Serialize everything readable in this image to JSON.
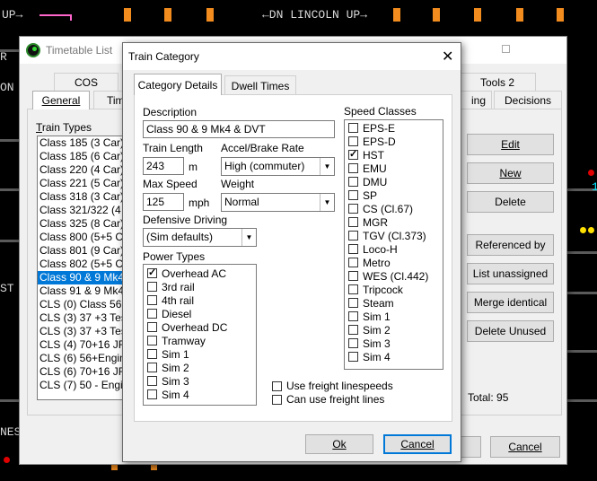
{
  "background": {
    "top_left_label": "UP→",
    "center_label": "←DN LINCOLN UP→",
    "left_labels": [
      "R",
      "ON",
      "ST",
      "NES"
    ],
    "right_label": "1"
  },
  "timetable_window": {
    "title": "Timetable List",
    "tabs_row1": [
      "COS",
      "Tools 2"
    ],
    "tabs_row2": [
      "General",
      "Tim",
      "ing",
      "Decisions"
    ],
    "train_types_label": "Train Types",
    "train_types": [
      "Class 185 (3 Car)",
      "Class 185 (6 Car)",
      "Class 220 (4 Car)",
      "Class 221 (5 Car)",
      "Class 318 (3 Car)",
      "Class 321/322 (4",
      "Class 325 (8 Car)",
      "Class 800 (5+5 C",
      "Class 801 (9 Car)",
      "Class 802 (5+5 C",
      "Class 90 & 9 Mk4",
      "Class 91 & 9 Mk4",
      "CLS (0) Class 56",
      "CLS (3) 37 +3 Tes",
      "CLS (3) 37 +3 Tes",
      "CLS (4) 70+16 JF",
      "CLS (6) 56+Engin",
      "CLS (6) 70+16 JF",
      "CLS (7) 50 - Engin"
    ],
    "selected_index": 10,
    "buttons": {
      "edit": "Edit",
      "new": "New",
      "delete": "Delete",
      "referenced_by": "Referenced by",
      "list_unassigned": "List unassigned",
      "merge_identical": "Merge identical",
      "delete_unused": "Delete Unused",
      "cancel": "Cancel"
    },
    "total_label": "Total: 95"
  },
  "category_dialog": {
    "title": "Train Category",
    "tabs": [
      "Category Details",
      "Dwell Times"
    ],
    "description_label": "Description",
    "description_value": "Class 90 & 9 Mk4 & DVT",
    "train_length_label": "Train Length",
    "train_length_value": "243",
    "train_length_unit": "m",
    "accel_label": "Accel/Brake Rate",
    "accel_value": "High (commuter)",
    "max_speed_label": "Max Speed",
    "max_speed_value": "125",
    "max_speed_unit": "mph",
    "weight_label": "Weight",
    "weight_value": "Normal",
    "defensive_label": "Defensive Driving",
    "defensive_value": "(Sim defaults)",
    "power_types_label": "Power Types",
    "power_types": [
      {
        "label": "Overhead AC",
        "checked": true
      },
      {
        "label": "3rd rail",
        "checked": false
      },
      {
        "label": "4th rail",
        "checked": false
      },
      {
        "label": "Diesel",
        "checked": false
      },
      {
        "label": "Overhead DC",
        "checked": false
      },
      {
        "label": "Tramway",
        "checked": false
      },
      {
        "label": "Sim 1",
        "checked": false
      },
      {
        "label": "Sim 2",
        "checked": false
      },
      {
        "label": "Sim 3",
        "checked": false
      },
      {
        "label": "Sim 4",
        "checked": false
      }
    ],
    "speed_classes_label": "Speed Classes",
    "speed_classes": [
      {
        "label": "EPS-E",
        "checked": false
      },
      {
        "label": "EPS-D",
        "checked": false
      },
      {
        "label": "HST",
        "checked": true
      },
      {
        "label": "EMU",
        "checked": false
      },
      {
        "label": "DMU",
        "checked": false
      },
      {
        "label": "SP",
        "checked": false
      },
      {
        "label": "CS (Cl.67)",
        "checked": false
      },
      {
        "label": "MGR",
        "checked": false
      },
      {
        "label": "TGV (Cl.373)",
        "checked": false
      },
      {
        "label": "Loco-H",
        "checked": false
      },
      {
        "label": "Metro",
        "checked": false
      },
      {
        "label": "WES (Cl.442)",
        "checked": false
      },
      {
        "label": "Tripcock",
        "checked": false
      },
      {
        "label": "Steam",
        "checked": false
      },
      {
        "label": "Sim 1",
        "checked": false
      },
      {
        "label": "Sim 2",
        "checked": false
      },
      {
        "label": "Sim 3",
        "checked": false
      },
      {
        "label": "Sim 4",
        "checked": false
      }
    ],
    "use_freight_linespeeds": "Use freight linespeeds",
    "can_use_freight_lines": "Can use freight lines",
    "ok": "Ok",
    "cancel": "Cancel"
  },
  "colors": {
    "signal_orange": "#f28c1e",
    "selection_blue": "#0078d7",
    "track_grey": "#5a5a5a"
  }
}
